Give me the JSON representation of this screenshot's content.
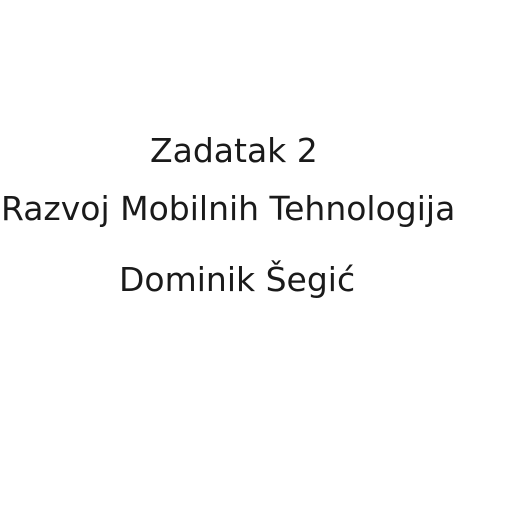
{
  "slide": {
    "title": "Zadatak 2",
    "course": "Razvoj Mobilnih Tehnologija",
    "author": "Dominik Šegić"
  }
}
